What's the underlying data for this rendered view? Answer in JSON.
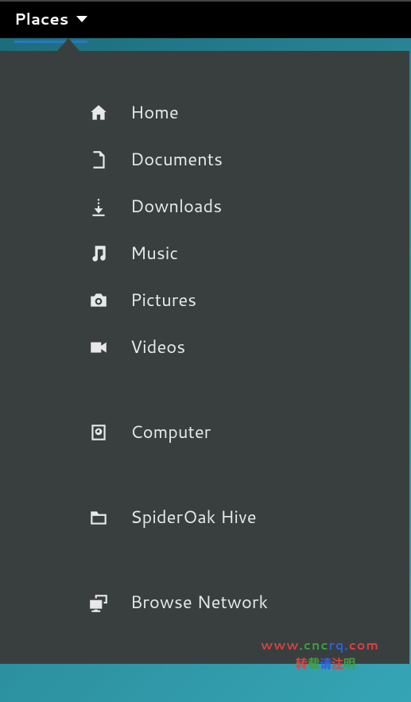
{
  "topbar": {
    "places_label": "Places"
  },
  "menu": {
    "sections": [
      {
        "items": [
          {
            "icon": "home-icon",
            "label": "Home"
          },
          {
            "icon": "document-icon",
            "label": "Documents"
          },
          {
            "icon": "download-icon",
            "label": "Downloads"
          },
          {
            "icon": "music-icon",
            "label": "Music"
          },
          {
            "icon": "camera-icon",
            "label": "Pictures"
          },
          {
            "icon": "video-icon",
            "label": "Videos"
          }
        ]
      },
      {
        "items": [
          {
            "icon": "computer-icon",
            "label": "Computer"
          }
        ]
      },
      {
        "items": [
          {
            "icon": "folder-icon",
            "label": "SpiderOak Hive"
          }
        ]
      },
      {
        "items": [
          {
            "icon": "network-icon",
            "label": "Browse Network"
          }
        ]
      }
    ]
  },
  "watermark": {
    "line1": "www.cncrq.com",
    "line2": "转载请注明"
  }
}
